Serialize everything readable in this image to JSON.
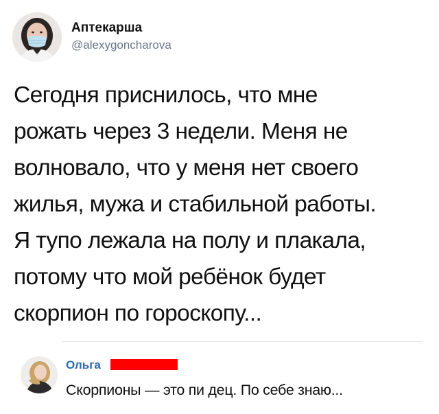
{
  "tweet": {
    "author_name": "Аптекарша",
    "author_handle": "@alexygoncharova",
    "text_lines": [
      "Сегодня приснилось, что мне",
      "рожать через 3 недели. Меня не",
      "волновало, что у меня нет своего",
      "жилья, мужа и стабильной работы.",
      "Я тупо лежала на полу и плакала,",
      "потому что мой ребёнок будет",
      "скорпион по гороскопу..."
    ]
  },
  "reply": {
    "author_name": "Ольга",
    "text": "Скорпионы — это пи  дец. По себе знаю..."
  },
  "colors": {
    "link_blue": "#2b6cb0",
    "handle_gray": "#6b7785",
    "redaction_red": "#ff0000",
    "divider": "#e3e6e9"
  }
}
